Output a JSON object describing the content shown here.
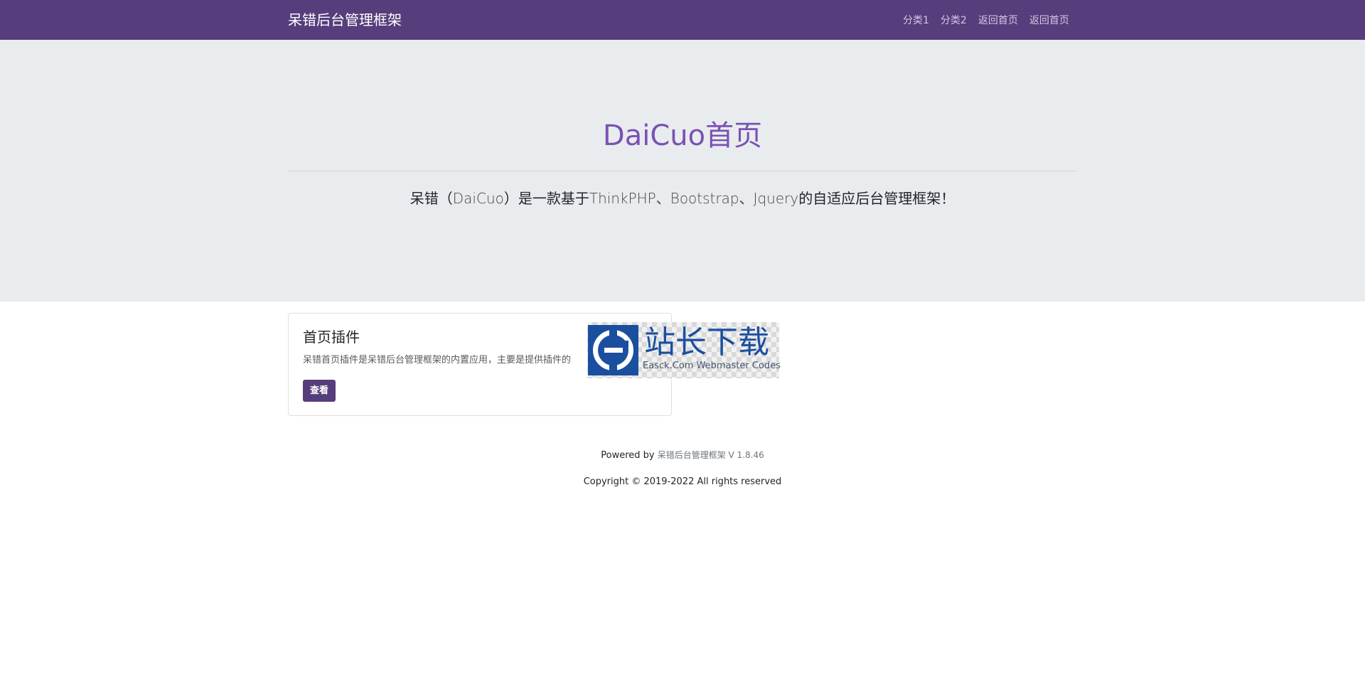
{
  "navbar": {
    "brand": "呆错后台管理框架",
    "links": [
      "分类1",
      "分类2",
      "返回首页",
      "返回首页"
    ]
  },
  "jumbotron": {
    "title": "DaiCuo首页",
    "lead_parts": [
      "呆错（",
      "DaiCuo",
      "）是一款基于",
      "ThinkPHP、Bootstrap、Jquery",
      "的自适应后台管理框架！"
    ]
  },
  "card": {
    "title": "首页插件",
    "text": "呆错首页插件是呆错后台管理框架的内置应用，主要是提供插件的",
    "button_label": "查看"
  },
  "watermark": {
    "cn_text": "站长下载",
    "en_text": "Easck.Com Webmaster Codes",
    "color": "#1a4fa0"
  },
  "footer": {
    "powered_prefix": "Powered by ",
    "powered_name": "呆错后台管理框架",
    "version": " V 1.8.46",
    "copyright": "Copyright © 2019-2022 All rights reserved"
  },
  "colors": {
    "navbar_bg": "#563d7c",
    "title_accent": "#7952b3",
    "jumbotron_bg": "#e9ecef"
  }
}
